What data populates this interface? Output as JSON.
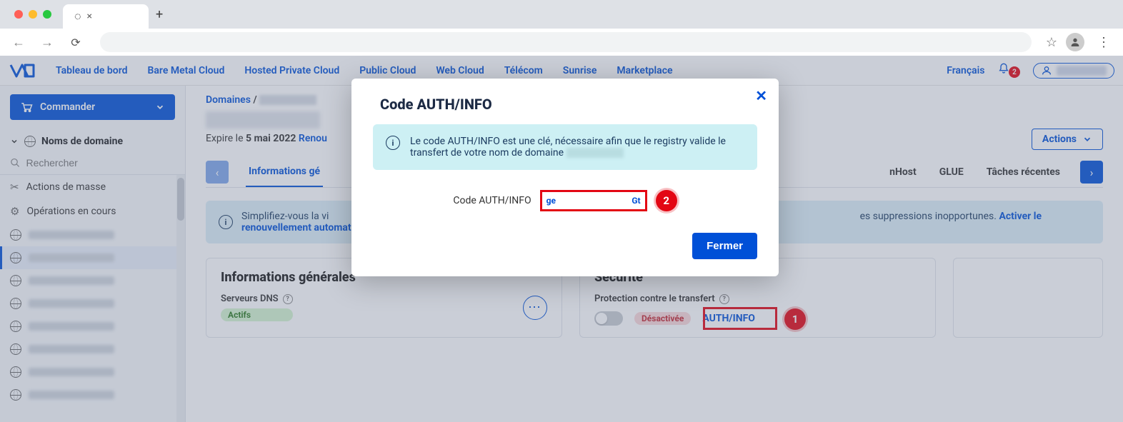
{
  "browser": {
    "newtab": "+",
    "tab_close": "×",
    "star": "☆",
    "menu_dots": "⋮"
  },
  "topnav": {
    "items": [
      "Tableau de bord",
      "Bare Metal Cloud",
      "Hosted Private Cloud",
      "Public Cloud",
      "Web Cloud",
      "Télécom",
      "Sunrise",
      "Marketplace"
    ],
    "language": "Français",
    "bell_count": "2"
  },
  "sidebar": {
    "order_label": "Commander",
    "section": "Noms de domaine",
    "search_placeholder": "Rechercher",
    "mass_actions": "Actions de masse",
    "ops_in_progress": "Opérations en cours"
  },
  "content": {
    "breadcrumb_root": "Domaines",
    "breadcrumb_sep": "/",
    "expires_prefix": "Expire le ",
    "expires_date": "5 mai 2022",
    "expires_link": "Renou",
    "actions_label": "Actions",
    "tabs": {
      "active": "Informations gé",
      "dynhost": "nHost",
      "glue": "GLUE",
      "recent": "Tâches récentes"
    },
    "banner_text_1": "Simplifiez-vous la vi",
    "banner_text_2": "es suppressions inopportunes. ",
    "banner_link": "Activer le renouvellement automatique",
    "card1_title": "Informations générales",
    "card1_sub": "Serveurs DNS",
    "card1_status": "Actifs",
    "card2_title": "Sécurité",
    "card2_sub": "Protection contre le transfert",
    "card2_status": "Désactivée",
    "authinfo_label": "AUTH/INFO"
  },
  "modal": {
    "title": "Code AUTH/INFO",
    "info_text": "Le code AUTH/INFO est une clé, nécessaire afin que le registry valide le transfert de votre nom de domaine ",
    "code_label": "Code AUTH/INFO",
    "code_prefix": "ge",
    "code_suffix": "Gt",
    "close_btn": "Fermer",
    "close_x": "✕"
  },
  "annotations": {
    "badge1": "1",
    "badge2": "2"
  }
}
